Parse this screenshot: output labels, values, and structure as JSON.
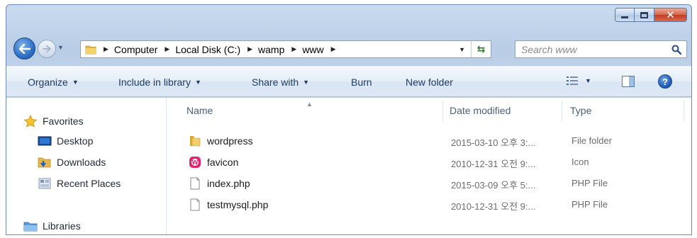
{
  "window": {
    "controls": [
      "minimize",
      "maximize",
      "close"
    ]
  },
  "navigation": {
    "breadcrumbs": [
      "Computer",
      "Local Disk (C:)",
      "wamp",
      "www"
    ],
    "search_placeholder": "Search www"
  },
  "toolbar": {
    "organize": "Organize",
    "include_in_library": "Include in library",
    "share_with": "Share with",
    "burn": "Burn",
    "new_folder": "New folder"
  },
  "nav_pane": {
    "favorites": "Favorites",
    "desktop": "Desktop",
    "downloads": "Downloads",
    "recent_places": "Recent Places",
    "libraries": "Libraries"
  },
  "columns": {
    "name": "Name",
    "date_modified": "Date modified",
    "type": "Type"
  },
  "files": [
    {
      "name": "wordpress",
      "date": "2015-03-10 오후 3:...",
      "type": "File folder",
      "icon": "folder-icon"
    },
    {
      "name": "favicon",
      "date": "2010-12-31 오전 9:...",
      "type": "Icon",
      "icon": "wamp-icon"
    },
    {
      "name": "index.php",
      "date": "2015-03-09 오후 5:...",
      "type": "PHP File",
      "icon": "file-icon"
    },
    {
      "name": "testmysql.php",
      "date": "2010-12-31 오전 9:...",
      "type": "PHP File",
      "icon": "file-icon"
    }
  ],
  "colors": {
    "accent": "#1e395b",
    "chrome": "#c9dbef",
    "close": "#c33a1f"
  }
}
